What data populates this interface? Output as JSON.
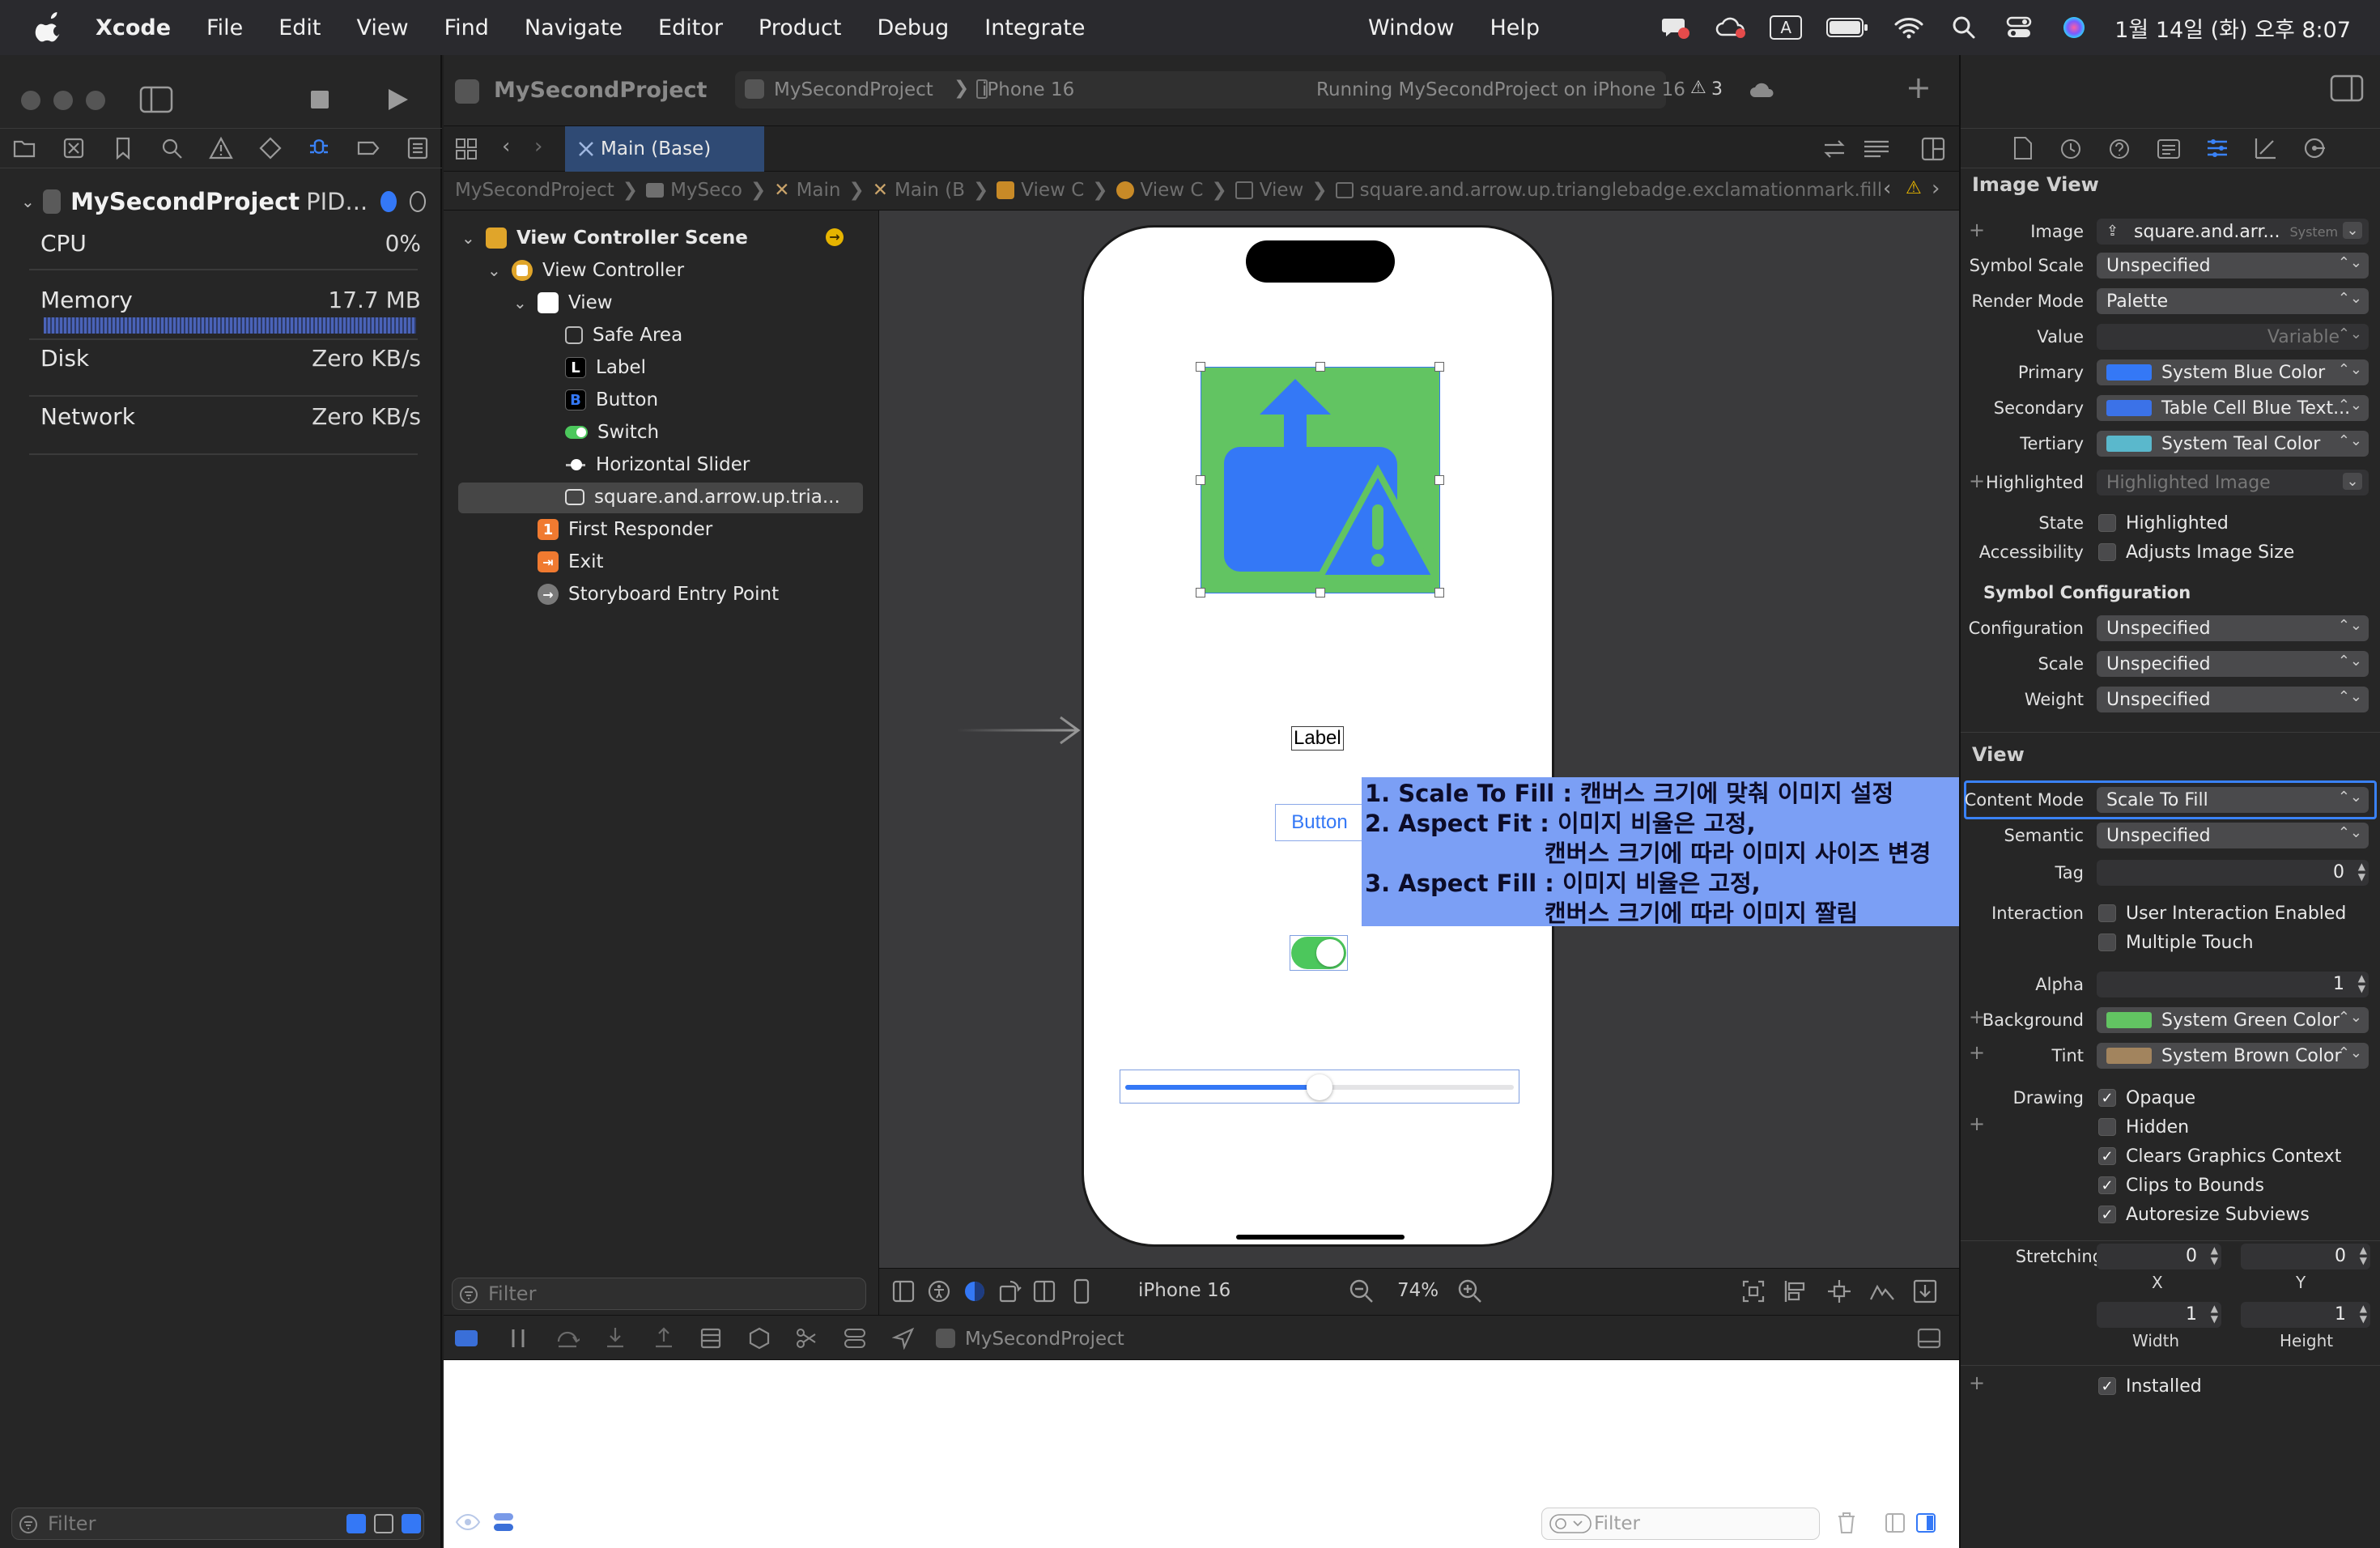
{
  "menubar": {
    "app": "Xcode",
    "items": [
      "File",
      "Edit",
      "View",
      "Find",
      "Navigate",
      "Editor",
      "Product",
      "Debug",
      "Integrate"
    ],
    "right_items": [
      "Window",
      "Help"
    ],
    "input_indicator": "A",
    "clock": "1월 14일 (화) 오후 8:07"
  },
  "debug_nav": {
    "project": "MySecondProject",
    "project_suffix": "PID...",
    "gauges": [
      {
        "name": "CPU",
        "value": "0%"
      },
      {
        "name": "Memory",
        "value": "17.7 MB"
      },
      {
        "name": "Disk",
        "value": "Zero KB/s"
      },
      {
        "name": "Network",
        "value": "Zero KB/s"
      }
    ],
    "filter_placeholder": "Filter"
  },
  "toolbar": {
    "project_title": "MySecondProject",
    "scheme": "MySecondProject",
    "device": "iPhone 16",
    "status": "Running MySecondProject on iPhone 16",
    "warnings": "3"
  },
  "tabs": [
    {
      "label": "Main (Base)",
      "active": true
    }
  ],
  "jumpbar": [
    "MySecondProject",
    "MySeco",
    "Main",
    "Main (B",
    "View C",
    "View C",
    "View",
    "square.and.arrow.up.trianglebadge.exclamationmark.fill"
  ],
  "outline": {
    "items": [
      {
        "label": "View Controller Scene",
        "icon": "scene-icon",
        "bold": true
      },
      {
        "label": "View Controller",
        "icon": "view-controller-icon"
      },
      {
        "label": "View",
        "icon": "view-icon"
      },
      {
        "label": "Safe Area",
        "icon": "safe-area-icon"
      },
      {
        "label": "Label",
        "icon": "label-icon",
        "glyph": "L"
      },
      {
        "label": "Button",
        "icon": "button-icon",
        "glyph": "B"
      },
      {
        "label": "Switch",
        "icon": "switch-icon"
      },
      {
        "label": "Horizontal Slider",
        "icon": "slider-icon"
      },
      {
        "label": "square.and.arrow.up.tria...",
        "icon": "image-view-icon",
        "selected": true
      },
      {
        "label": "First Responder",
        "icon": "first-responder-icon",
        "glyph": "1"
      },
      {
        "label": "Exit",
        "icon": "exit-icon"
      },
      {
        "label": "Storyboard Entry Point",
        "icon": "entry-point-icon"
      }
    ],
    "filter_placeholder": "Filter"
  },
  "canvas": {
    "label_text": "Label",
    "button_text": "Button",
    "slider_value": 0.5,
    "switch_on": true,
    "annotation": [
      "1. Scale To Fill : 캔버스 크기에 맞춰 이미지 설정",
      "2. Aspect Fit : 이미지 비율은 고정,",
      "캔버스 크기에 따라 이미지 사이즈 변경",
      "3. Aspect Fill : 이미지 비율은 고정,",
      "캔버스 크기에 따라 이미지 짤림"
    ],
    "colors": {
      "image_bg": "#62c462",
      "symbol": "#3478f6",
      "annotation_bg": "#7b9ff5"
    }
  },
  "canvas_bar": {
    "device": "iPhone 16",
    "zoom": "74%"
  },
  "debug_bar": {
    "target": "MySecondProject"
  },
  "console": {
    "filter_placeholder": "Filter"
  },
  "inspector": {
    "section_image_view": "Image View",
    "image": {
      "label": "Image",
      "value": "square.and.arr...",
      "tag": "System"
    },
    "symbol_scale": {
      "label": "Symbol Scale",
      "value": "Unspecified"
    },
    "render_mode": {
      "label": "Render Mode",
      "value": "Palette"
    },
    "value": {
      "label": "Value",
      "value": "Variable"
    },
    "primary": {
      "label": "Primary",
      "value": "System Blue Color",
      "color": "#3478f6"
    },
    "secondary": {
      "label": "Secondary",
      "value": "Table Cell Blue Text...",
      "color": "#3b72e8"
    },
    "tertiary": {
      "label": "Tertiary",
      "value": "System Teal Color",
      "color": "#5ab8cc"
    },
    "highlighted": {
      "label": "Highlighted",
      "value": "Highlighted Image"
    },
    "state": {
      "label": "State",
      "check": "Highlighted"
    },
    "accessibility": {
      "label": "Accessibility",
      "check": "Adjusts Image Size"
    },
    "section_symbol_config": "Symbol Configuration",
    "configuration": {
      "label": "Configuration",
      "value": "Unspecified"
    },
    "scale": {
      "label": "Scale",
      "value": "Unspecified"
    },
    "weight": {
      "label": "Weight",
      "value": "Unspecified"
    },
    "section_view": "View",
    "content_mode": {
      "label": "Content Mode",
      "value": "Scale To Fill"
    },
    "semantic": {
      "label": "Semantic",
      "value": "Unspecified"
    },
    "tag": {
      "label": "Tag",
      "value": "0"
    },
    "interaction": {
      "label": "Interaction",
      "check1": "User Interaction Enabled",
      "check2": "Multiple Touch"
    },
    "alpha": {
      "label": "Alpha",
      "value": "1"
    },
    "background": {
      "label": "Background",
      "value": "System Green Color",
      "color": "#62c462"
    },
    "tint": {
      "label": "Tint",
      "value": "System Brown Color",
      "color": "#a2845e"
    },
    "drawing": {
      "label": "Drawing",
      "checks": [
        {
          "label": "Opaque",
          "checked": true
        },
        {
          "label": "Hidden",
          "checked": false
        },
        {
          "label": "Clears Graphics Context",
          "checked": true
        },
        {
          "label": "Clips to Bounds",
          "checked": true
        },
        {
          "label": "Autoresize Subviews",
          "checked": true
        }
      ]
    },
    "stretching": {
      "label": "Stretching",
      "x": "0",
      "y": "0",
      "width": "1",
      "height": "1",
      "x_label": "X",
      "y_label": "Y",
      "w_label": "Width",
      "h_label": "Height"
    },
    "installed": {
      "label": "Installed",
      "checked": true
    }
  }
}
